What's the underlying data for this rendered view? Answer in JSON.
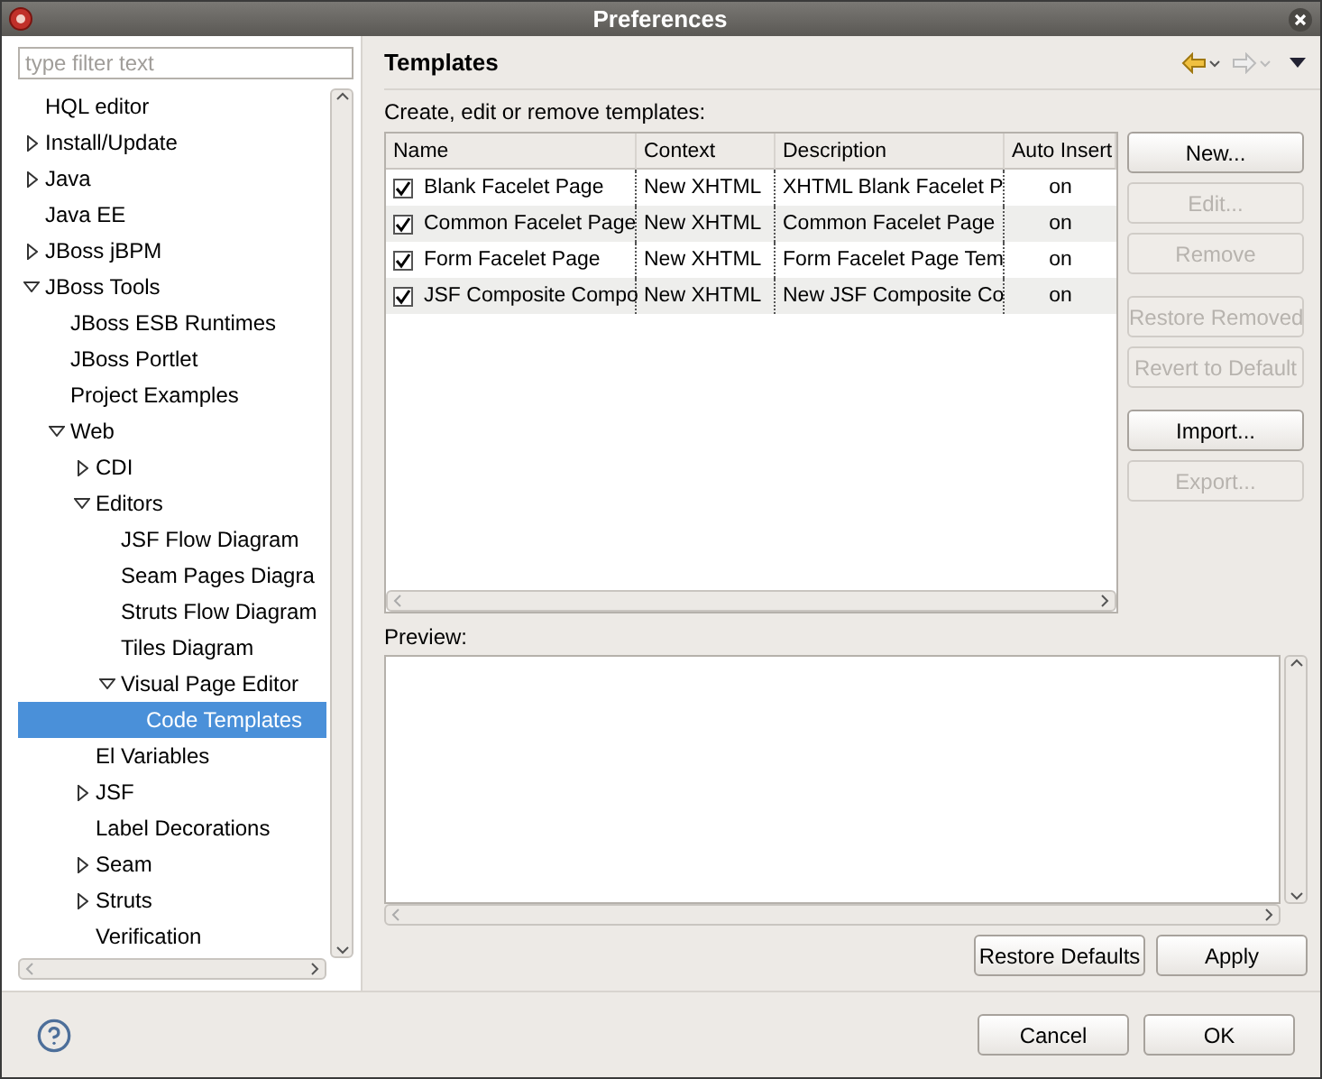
{
  "window": {
    "title": "Preferences"
  },
  "filter": {
    "placeholder": "type filter text"
  },
  "tree": [
    {
      "label": "HQL editor",
      "selected": false
    },
    {
      "label": "Install/Update",
      "expanded": false,
      "selected": false
    },
    {
      "label": "Java",
      "expanded": false,
      "selected": false
    },
    {
      "label": "Java EE",
      "selected": false
    },
    {
      "label": "JBoss jBPM",
      "expanded": false,
      "selected": false
    },
    {
      "label": "JBoss Tools",
      "expanded": true,
      "selected": false,
      "children": [
        {
          "label": "JBoss ESB Runtimes",
          "selected": false
        },
        {
          "label": "JBoss Portlet",
          "selected": false
        },
        {
          "label": "Project Examples",
          "selected": false
        },
        {
          "label": "Web",
          "expanded": true,
          "selected": false,
          "children": [
            {
              "label": "CDI",
              "expanded": false,
              "selected": false
            },
            {
              "label": "Editors",
              "expanded": true,
              "selected": false,
              "children": [
                {
                  "label": "JSF Flow Diagram",
                  "selected": false
                },
                {
                  "label": "Seam Pages Diagra",
                  "selected": false
                },
                {
                  "label": "Struts Flow Diagram",
                  "selected": false
                },
                {
                  "label": "Tiles Diagram",
                  "selected": false
                },
                {
                  "label": "Visual Page Editor",
                  "expanded": true,
                  "selected": false,
                  "children": [
                    {
                      "label": "Code Templates",
                      "selected": true
                    }
                  ]
                }
              ]
            },
            {
              "label": "El Variables",
              "selected": false
            },
            {
              "label": "JSF",
              "expanded": false,
              "selected": false
            },
            {
              "label": "Label Decorations",
              "selected": false
            },
            {
              "label": "Seam",
              "expanded": false,
              "selected": false
            },
            {
              "label": "Struts",
              "expanded": false,
              "selected": false
            },
            {
              "label": "Verification",
              "selected": false
            }
          ]
        }
      ]
    }
  ],
  "page": {
    "title": "Templates",
    "intro": "Create, edit or remove templates:"
  },
  "table": {
    "columns": [
      "Name",
      "Context",
      "Description",
      "Auto Insert"
    ],
    "rows": [
      {
        "checked": true,
        "name": "Blank Facelet Page",
        "context": "New XHTML",
        "description": "XHTML Blank Facelet P",
        "auto_insert": "on"
      },
      {
        "checked": true,
        "name": "Common Facelet Page",
        "context": "New XHTML",
        "description": "Common Facelet Page",
        "auto_insert": "on"
      },
      {
        "checked": true,
        "name": "Form Facelet Page",
        "context": "New XHTML",
        "description": "Form Facelet Page Tem",
        "auto_insert": "on"
      },
      {
        "checked": true,
        "name": "JSF Composite Compo",
        "context": "New XHTML",
        "description": "New JSF Composite Co",
        "auto_insert": "on"
      }
    ]
  },
  "side_button_groups": [
    [
      {
        "label": "New...",
        "disabled": false
      },
      {
        "label": "Edit...",
        "disabled": true
      },
      {
        "label": "Remove",
        "disabled": true
      }
    ],
    [
      {
        "label": "Restore Removed",
        "disabled": true
      },
      {
        "label": "Revert to Default",
        "disabled": true
      }
    ],
    [
      {
        "label": "Import...",
        "disabled": false
      },
      {
        "label": "Export...",
        "disabled": true
      }
    ]
  ],
  "preview": {
    "label": "Preview:"
  },
  "page_buttons": [
    "Restore Defaults",
    "Apply"
  ],
  "dialog_buttons": [
    "Cancel",
    "OK"
  ]
}
